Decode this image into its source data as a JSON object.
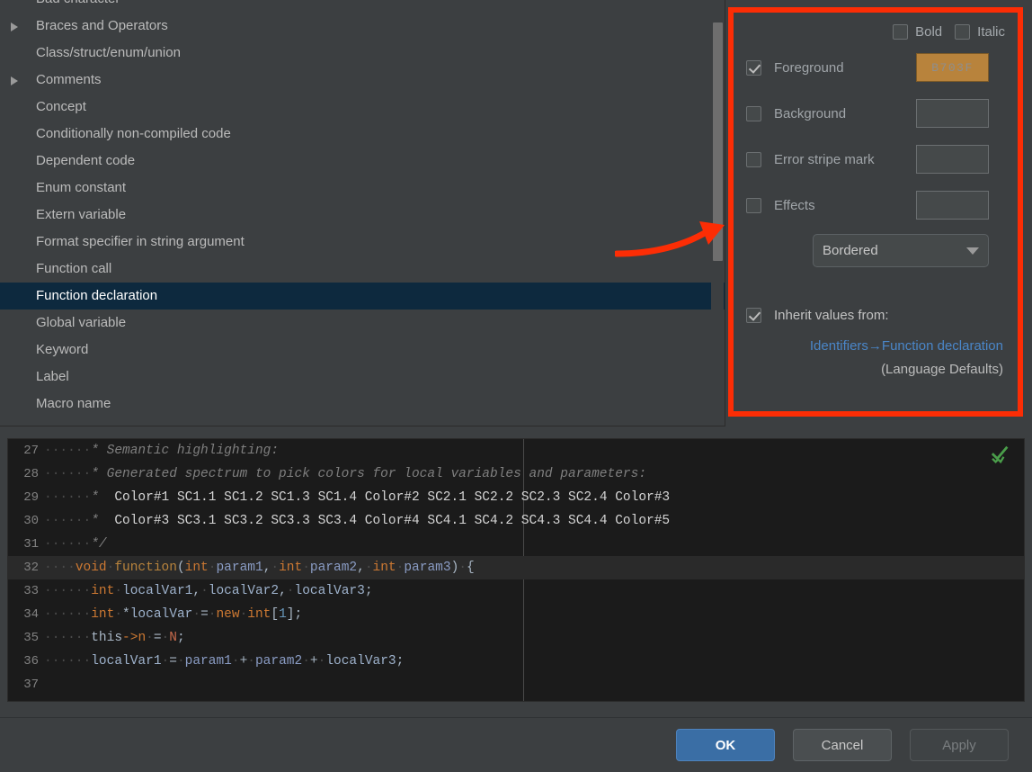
{
  "scheme_list": {
    "items": [
      {
        "label": "Bad character",
        "expandable": false,
        "selected": false,
        "partial_top": true
      },
      {
        "label": "Braces and Operators",
        "expandable": true,
        "selected": false
      },
      {
        "label": "Class/struct/enum/union",
        "expandable": false,
        "selected": false
      },
      {
        "label": "Comments",
        "expandable": true,
        "selected": false
      },
      {
        "label": "Concept",
        "expandable": false,
        "selected": false
      },
      {
        "label": "Conditionally non-compiled code",
        "expandable": false,
        "selected": false
      },
      {
        "label": "Dependent code",
        "expandable": false,
        "selected": false
      },
      {
        "label": "Enum constant",
        "expandable": false,
        "selected": false
      },
      {
        "label": "Extern variable",
        "expandable": false,
        "selected": false
      },
      {
        "label": "Format specifier in string argument",
        "expandable": false,
        "selected": false
      },
      {
        "label": "Function call",
        "expandable": false,
        "selected": false
      },
      {
        "label": "Function declaration",
        "expandable": false,
        "selected": true
      },
      {
        "label": "Global variable",
        "expandable": false,
        "selected": false
      },
      {
        "label": "Keyword",
        "expandable": false,
        "selected": false
      },
      {
        "label": "Label",
        "expandable": false,
        "selected": false
      },
      {
        "label": "Macro name",
        "expandable": false,
        "selected": false
      }
    ]
  },
  "attributes": {
    "font_style": {
      "bold_label": "Bold",
      "bold_checked": false,
      "italic_label": "Italic",
      "italic_checked": false
    },
    "rows": [
      {
        "label": "Foreground",
        "checked": true,
        "swatch_value": "B703F",
        "swatch_color": "#b8833c",
        "filled": true
      },
      {
        "label": "Background",
        "checked": false,
        "swatch_value": "",
        "filled": false
      },
      {
        "label": "Error stripe mark",
        "checked": false,
        "swatch_value": "",
        "filled": false
      },
      {
        "label": "Effects",
        "checked": false,
        "swatch_value": "",
        "filled": false
      }
    ],
    "effects_select": {
      "value": "Bordered"
    },
    "inherit": {
      "label": "Inherit values from:",
      "checked": true,
      "link_text": "Identifiers→Function declaration",
      "sub_text": "(Language Defaults)"
    },
    "accent_highlight_color": "#fc2d05"
  },
  "preview": {
    "lines": [
      {
        "n": "27",
        "parts": [
          {
            "t": "······",
            "c": "ws"
          },
          {
            "t": "* Semantic highlighting:",
            "c": "cmt"
          }
        ]
      },
      {
        "n": "28",
        "parts": [
          {
            "t": "······",
            "c": "ws"
          },
          {
            "t": "* Generated spectrum to pick colors for local variables and parameters:",
            "c": "cmt"
          }
        ]
      },
      {
        "n": "29",
        "parts": [
          {
            "t": "······",
            "c": "ws"
          },
          {
            "t": "* ",
            "c": "cmt"
          },
          {
            "t": " Color#1 SC1.1 SC1.2 SC1.3 SC1.4 Color#2 SC2.1 SC2.2 SC2.3 SC2.4 Color#3",
            "c": "cmt-doc"
          }
        ]
      },
      {
        "n": "30",
        "parts": [
          {
            "t": "······",
            "c": "ws"
          },
          {
            "t": "* ",
            "c": "cmt"
          },
          {
            "t": " Color#3 SC3.1 SC3.2 SC3.3 SC3.4 Color#4 SC4.1 SC4.2 SC4.3 SC4.4 Color#5",
            "c": "cmt-doc"
          }
        ]
      },
      {
        "n": "31",
        "parts": [
          {
            "t": "······",
            "c": "ws"
          },
          {
            "t": "*/",
            "c": "cmt"
          }
        ]
      },
      {
        "n": "32",
        "caret": true,
        "parts": [
          {
            "t": "····",
            "c": "ws"
          },
          {
            "t": "void",
            "c": "kw"
          },
          {
            "t": "·",
            "c": "ws"
          },
          {
            "t": "function",
            "c": "fn"
          },
          {
            "t": "(",
            "c": "brace"
          },
          {
            "t": "int",
            "c": "kw"
          },
          {
            "t": "·",
            "c": "ws"
          },
          {
            "t": "param1",
            "c": "param"
          },
          {
            "t": ",",
            "c": "op"
          },
          {
            "t": "·",
            "c": "ws"
          },
          {
            "t": "int",
            "c": "kw"
          },
          {
            "t": "·",
            "c": "ws"
          },
          {
            "t": "param2",
            "c": "param"
          },
          {
            "t": ",",
            "c": "op"
          },
          {
            "t": "·",
            "c": "ws"
          },
          {
            "t": "int",
            "c": "kw"
          },
          {
            "t": "·",
            "c": "ws"
          },
          {
            "t": "param3",
            "c": "param"
          },
          {
            "t": ")",
            "c": "brace"
          },
          {
            "t": "·",
            "c": "ws"
          },
          {
            "t": "{",
            "c": "brace"
          }
        ]
      },
      {
        "n": "33",
        "parts": [
          {
            "t": "······",
            "c": "ws"
          },
          {
            "t": "int",
            "c": "kw"
          },
          {
            "t": "·",
            "c": "ws"
          },
          {
            "t": "localVar1",
            "c": "lvar"
          },
          {
            "t": ",",
            "c": "op"
          },
          {
            "t": "·",
            "c": "ws"
          },
          {
            "t": "localVar2",
            "c": "lvar"
          },
          {
            "t": ",",
            "c": "op"
          },
          {
            "t": "·",
            "c": "ws"
          },
          {
            "t": "localVar3",
            "c": "lvar"
          },
          {
            "t": ";",
            "c": "op"
          }
        ]
      },
      {
        "n": "34",
        "parts": [
          {
            "t": "······",
            "c": "ws"
          },
          {
            "t": "int",
            "c": "kw"
          },
          {
            "t": "·",
            "c": "ws"
          },
          {
            "t": "*",
            "c": "op"
          },
          {
            "t": "localVar",
            "c": "lvar"
          },
          {
            "t": "·",
            "c": "ws"
          },
          {
            "t": "=",
            "c": "op"
          },
          {
            "t": "·",
            "c": "ws"
          },
          {
            "t": "new",
            "c": "kw"
          },
          {
            "t": "·",
            "c": "ws"
          },
          {
            "t": "int",
            "c": "kw"
          },
          {
            "t": "[",
            "c": "brace"
          },
          {
            "t": "1",
            "c": "num"
          },
          {
            "t": "];",
            "c": "op"
          }
        ]
      },
      {
        "n": "35",
        "parts": [
          {
            "t": "······",
            "c": "ws"
          },
          {
            "t": "this",
            "c": "op"
          },
          {
            "t": "->",
            "c": "kw"
          },
          {
            "t": "n",
            "c": "fld"
          },
          {
            "t": "·",
            "c": "ws"
          },
          {
            "t": "=",
            "c": "op"
          },
          {
            "t": "·",
            "c": "ws"
          },
          {
            "t": "N",
            "c": "macro"
          },
          {
            "t": ";",
            "c": "op"
          }
        ]
      },
      {
        "n": "36",
        "parts": [
          {
            "t": "······",
            "c": "ws"
          },
          {
            "t": "localVar1",
            "c": "lvar"
          },
          {
            "t": "·",
            "c": "ws"
          },
          {
            "t": "=",
            "c": "op"
          },
          {
            "t": "·",
            "c": "ws"
          },
          {
            "t": "param1",
            "c": "param"
          },
          {
            "t": "·",
            "c": "ws"
          },
          {
            "t": "+",
            "c": "op"
          },
          {
            "t": "·",
            "c": "ws"
          },
          {
            "t": "param2",
            "c": "param"
          },
          {
            "t": "·",
            "c": "ws"
          },
          {
            "t": "+",
            "c": "op"
          },
          {
            "t": "·",
            "c": "ws"
          },
          {
            "t": "localVar3",
            "c": "lvar"
          },
          {
            "t": ";",
            "c": "op"
          }
        ]
      },
      {
        "n": "37",
        "parts": []
      }
    ],
    "inspection_status_icon": "double-check-icon",
    "inspection_status_color": "#4a9e4a"
  },
  "buttons": {
    "ok": "OK",
    "cancel": "Cancel",
    "apply": "Apply",
    "apply_disabled": true
  }
}
